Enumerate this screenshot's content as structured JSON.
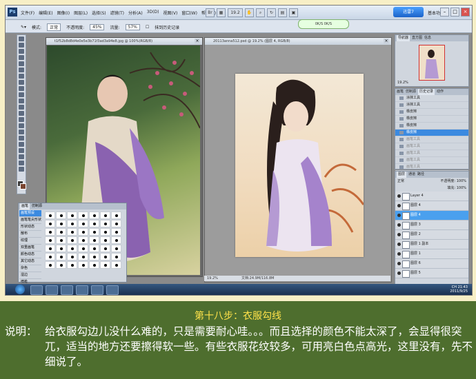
{
  "app": {
    "logo_text": "Ps",
    "menus": [
      "文件(F)",
      "编辑(E)",
      "图像(I)",
      "图层(L)",
      "选择(S)",
      "滤镜(T)",
      "分析(A)",
      "3D(D)",
      "视图(V)",
      "窗口(W)",
      "帮助(H)"
    ],
    "zoom_select": "19.2",
    "badge_text": "迅雷7",
    "workspace": "基本功能",
    "speed_readout": "0K/S  0K/S"
  },
  "options_bar": {
    "size_label": "模式:",
    "mode_value": "正常",
    "opacity_label": "不透明度:",
    "opacity_value": "45%",
    "flow_label": "流量:",
    "flow_value": "57%",
    "history_label": "抹到历史记录"
  },
  "doc1": {
    "title": "t1f52b8d8d4e0e5e3b71f3ad3a94e8.jpg @ 100%(RGB/8)"
  },
  "doc2": {
    "title": "20113anna512.psd @ 19.2% (图层 4, RGB/8)",
    "status_zoom": "19.2%",
    "status_doc": "文档:24.9M/116.8M"
  },
  "navigator": {
    "tabs": [
      "导航器",
      "直方图",
      "信息"
    ],
    "zoom": "19.2%"
  },
  "history": {
    "tabs": [
      "画笔",
      "仿制源",
      "历史记录",
      "动作"
    ],
    "items": [
      {
        "label": "涂抹工具",
        "state": "normal"
      },
      {
        "label": "涂抹工具",
        "state": "normal"
      },
      {
        "label": "橡皮擦",
        "state": "normal"
      },
      {
        "label": "橡皮擦",
        "state": "normal"
      },
      {
        "label": "橡皮擦",
        "state": "normal"
      },
      {
        "label": "橡皮擦",
        "state": "sel"
      },
      {
        "label": "画笔工具",
        "state": "dim"
      },
      {
        "label": "画笔工具",
        "state": "dim"
      },
      {
        "label": "画笔工具",
        "state": "dim"
      },
      {
        "label": "画笔工具",
        "state": "dim"
      },
      {
        "label": "画笔工具",
        "state": "dim"
      }
    ]
  },
  "layers": {
    "tabs": [
      "图层",
      "通道",
      "路径"
    ],
    "blend_mode": "正常",
    "opacity_label": "不透明度:",
    "opacity_value": "100%",
    "fill_label": "填充:",
    "fill_value": "100%",
    "items": [
      {
        "label": "Layer 4",
        "selected": false
      },
      {
        "label": "图层 4",
        "selected": false
      },
      {
        "label": "图层 4",
        "selected": true
      },
      {
        "label": "图层 3",
        "selected": false
      },
      {
        "label": "图层 2",
        "selected": false
      },
      {
        "label": "图层 1 副本",
        "selected": false
      },
      {
        "label": "图层 1",
        "selected": false
      },
      {
        "label": "图层 6",
        "selected": false
      },
      {
        "label": "图层 5",
        "selected": false
      }
    ]
  },
  "brushes_panel": {
    "tabs": [
      "画笔",
      "仿制源"
    ],
    "items": [
      {
        "label": "画笔预设",
        "selected": true
      },
      {
        "label": "画笔笔尖形状",
        "selected": false
      },
      {
        "label": "形状动态",
        "selected": false
      },
      {
        "label": "散布",
        "selected": false
      },
      {
        "label": "纹理",
        "selected": false
      },
      {
        "label": "双重画笔",
        "selected": false
      },
      {
        "label": "颜色动态",
        "selected": false
      },
      {
        "label": "其它动态",
        "selected": false
      },
      {
        "label": "杂色",
        "selected": false
      },
      {
        "label": "湿边",
        "selected": false
      },
      {
        "label": "喷枪",
        "selected": false
      }
    ]
  },
  "taskbar": {
    "time": "21:43",
    "date": "2011/9/25",
    "lang": "CH"
  },
  "caption": {
    "step_title": "第十八步：衣服勾线",
    "desc_label": "说明：",
    "desc_body": "给衣服勾边儿没什么难的，只是需要耐心哇。。。而且选择的颜色不能太深了，会显得很突兀，适当的地方还要擦得软一些。有些衣服花纹较多，可用亮白色点高光，这里没有，先不细说了。"
  }
}
